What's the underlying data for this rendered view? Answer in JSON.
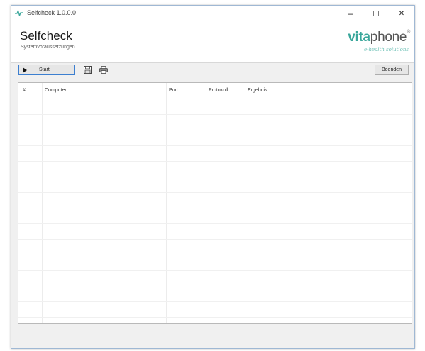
{
  "window": {
    "title": "Selfcheck 1.0.0.0",
    "minimize_glyph": "–",
    "maximize_glyph": "☐",
    "close_glyph": "✕"
  },
  "header": {
    "title": "Selfcheck",
    "subtitle": "Systemvoraussetzungen",
    "logo": {
      "brand_part1": "vita",
      "brand_part2": "phone",
      "registered": "®",
      "tagline": "e-health solutions"
    }
  },
  "toolbar": {
    "start_label": "Start",
    "close_label": "Beenden",
    "icons": [
      "play-icon",
      "save-icon",
      "print-icon"
    ]
  },
  "table": {
    "columns": [
      "#",
      "Computer",
      "Port",
      "Protokoll",
      "Ergebnis"
    ],
    "rows": []
  },
  "colors": {
    "brand_teal": "#3aa79b",
    "focus_border": "#3c7fd0",
    "window_bg": "#f0f0f0"
  }
}
